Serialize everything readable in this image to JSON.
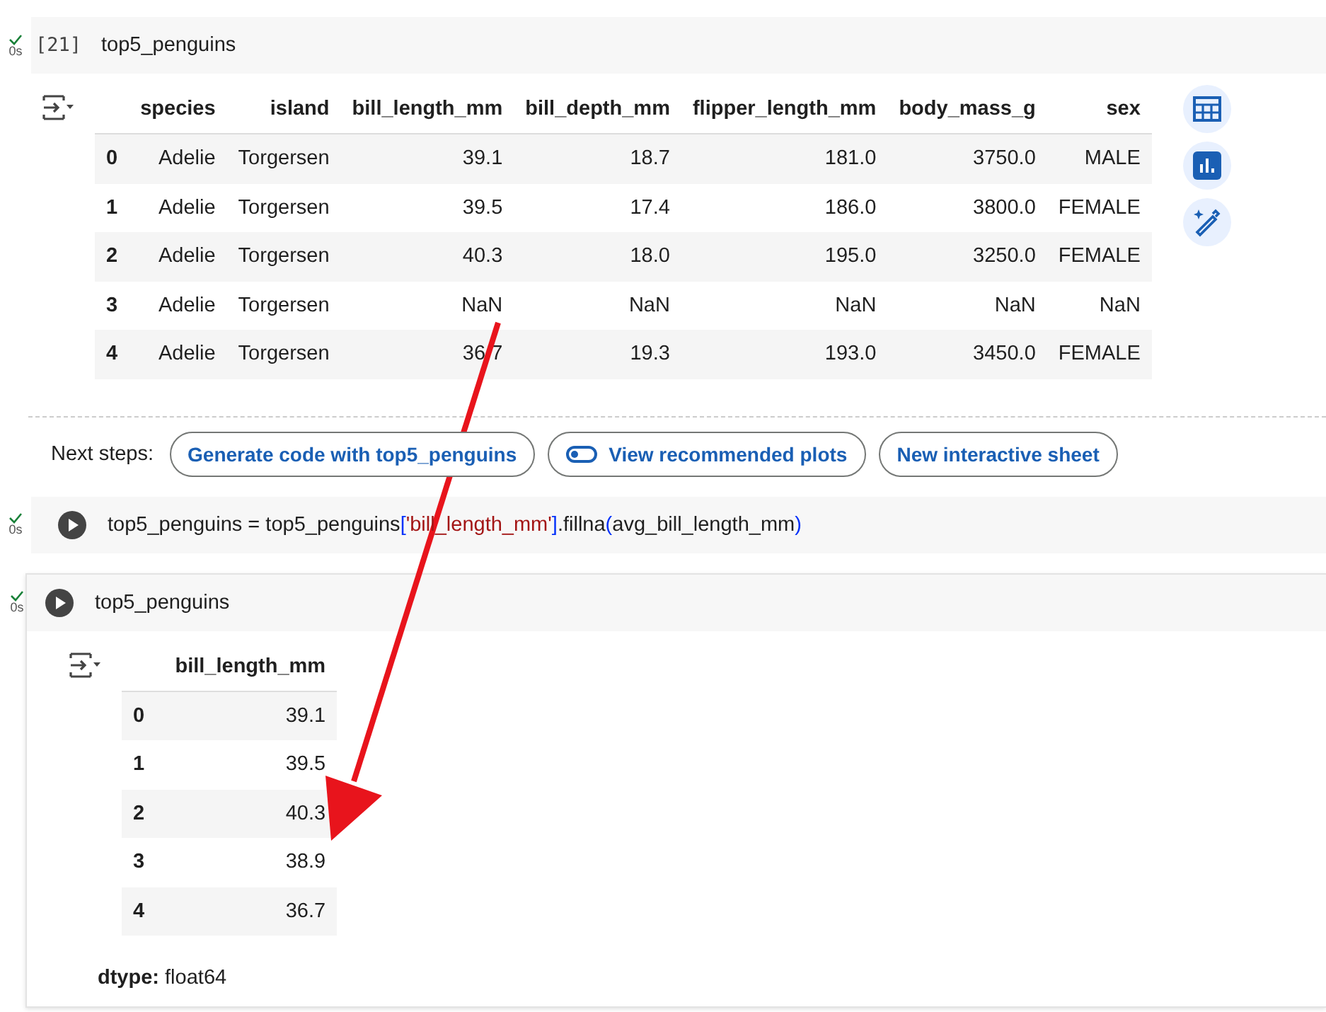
{
  "cells": [
    {
      "kind": "result",
      "status": "0s",
      "done": true,
      "exec_count": "[21]",
      "code": [
        {
          "kind": "plain",
          "text": "top5_penguins"
        }
      ],
      "output": {
        "columns": [
          "species",
          "island",
          "bill_length_mm",
          "bill_depth_mm",
          "flipper_length_mm",
          "body_mass_g",
          "sex"
        ],
        "rows": [
          {
            "index": "0",
            "cells": [
              "Adelie",
              "Torgersen",
              "39.1",
              "18.7",
              "181.0",
              "3750.0",
              "MALE"
            ]
          },
          {
            "index": "1",
            "cells": [
              "Adelie",
              "Torgersen",
              "39.5",
              "17.4",
              "186.0",
              "3800.0",
              "FEMALE"
            ]
          },
          {
            "index": "2",
            "cells": [
              "Adelie",
              "Torgersen",
              "40.3",
              "18.0",
              "195.0",
              "3250.0",
              "FEMALE"
            ]
          },
          {
            "index": "3",
            "cells": [
              "Adelie",
              "Torgersen",
              "NaN",
              "NaN",
              "NaN",
              "NaN",
              "NaN"
            ]
          },
          {
            "index": "4",
            "cells": [
              "Adelie",
              "Torgersen",
              "36.7",
              "19.3",
              "193.0",
              "3450.0",
              "FEMALE"
            ]
          }
        ],
        "side_tools": true
      },
      "next_steps": {
        "label": "Next steps:",
        "buttons": [
          {
            "label": "Generate code with top5_penguins",
            "kind": "text"
          },
          {
            "label": "View recommended plots",
            "kind": "toggle"
          },
          {
            "label": "New interactive sheet",
            "kind": "text"
          }
        ]
      }
    },
    {
      "kind": "run",
      "status": "0s",
      "done": true,
      "code": [
        {
          "kind": "plain",
          "text": "top5_penguins = top5_penguins"
        },
        {
          "kind": "bracket",
          "text": "["
        },
        {
          "kind": "string",
          "text": "'bill_length_mm'"
        },
        {
          "kind": "bracket",
          "text": "]"
        },
        {
          "kind": "plain",
          "text": ".fillna"
        },
        {
          "kind": "bracket",
          "text": "("
        },
        {
          "kind": "plain",
          "text": "avg_bill_length_mm"
        },
        {
          "kind": "bracket",
          "text": ")"
        }
      ]
    },
    {
      "kind": "run",
      "status": "0s",
      "done": true,
      "focused": true,
      "code": [
        {
          "kind": "plain",
          "text": "top5_penguins"
        }
      ],
      "output": {
        "columns": [
          "bill_length_mm"
        ],
        "rows": [
          {
            "index": "0",
            "cells": [
              "39.1"
            ]
          },
          {
            "index": "1",
            "cells": [
              "39.5"
            ]
          },
          {
            "index": "2",
            "cells": [
              "40.3"
            ]
          },
          {
            "index": "3",
            "cells": [
              "38.9"
            ]
          },
          {
            "index": "4",
            "cells": [
              "36.7"
            ]
          }
        ],
        "dtype": {
          "label": "dtype:",
          "value": "float64"
        }
      }
    }
  ]
}
